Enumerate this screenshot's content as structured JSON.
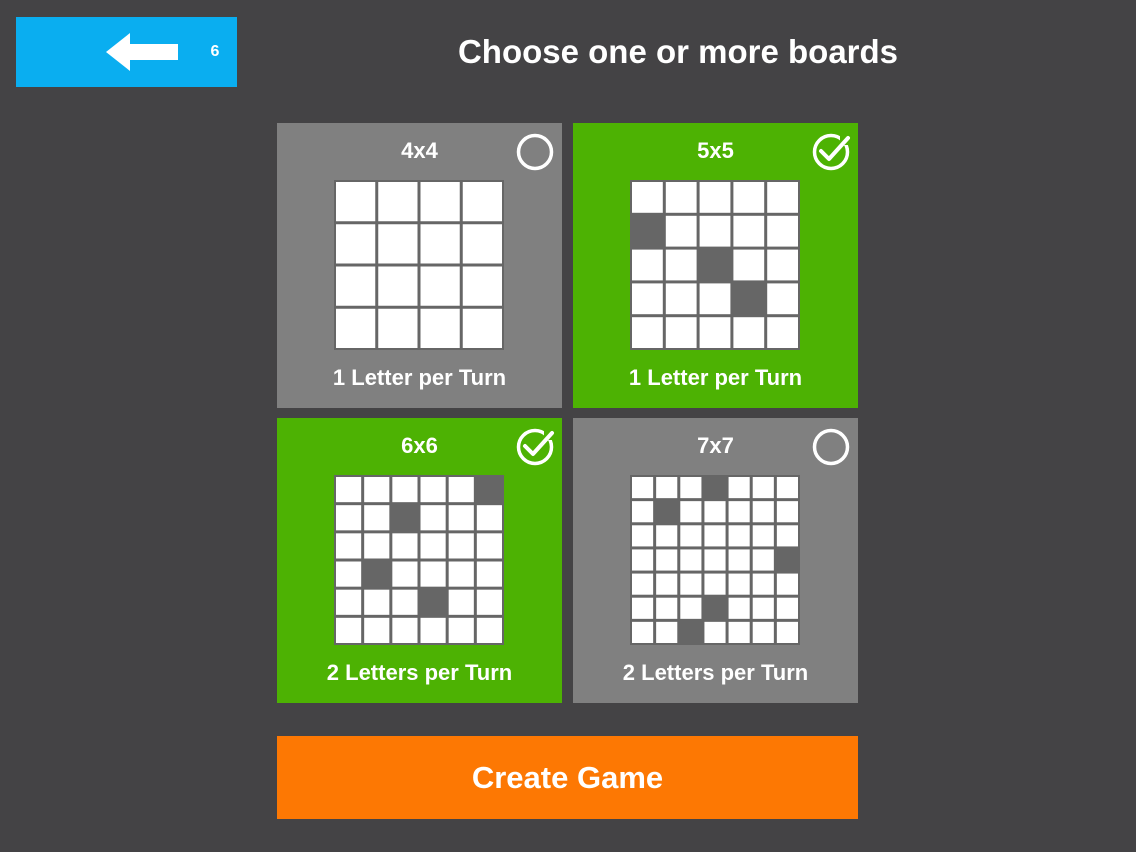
{
  "header": {
    "back_count": "6",
    "title": "Choose one or more boards",
    "back_color": "#0aaef0"
  },
  "boards": [
    {
      "size_label": "4x4",
      "n": 4,
      "mode_label": "1 Letter per Turn",
      "selected": false,
      "dark_cells": []
    },
    {
      "size_label": "5x5",
      "n": 5,
      "mode_label": "1 Letter per Turn",
      "selected": true,
      "dark_cells": [
        [
          1,
          0
        ],
        [
          2,
          2
        ],
        [
          3,
          3
        ]
      ]
    },
    {
      "size_label": "6x6",
      "n": 6,
      "mode_label": "2 Letters per Turn",
      "selected": true,
      "dark_cells": [
        [
          0,
          5
        ],
        [
          1,
          2
        ],
        [
          3,
          1
        ],
        [
          4,
          3
        ]
      ]
    },
    {
      "size_label": "7x7",
      "n": 7,
      "mode_label": "2 Letters per Turn",
      "selected": false,
      "dark_cells": [
        [
          0,
          3
        ],
        [
          1,
          1
        ],
        [
          3,
          6
        ],
        [
          5,
          3
        ],
        [
          6,
          2
        ]
      ]
    }
  ],
  "create_button": {
    "label": "Create Game",
    "color": "#fd7803"
  },
  "colors": {
    "background": "#444345",
    "card_default": "#808080",
    "card_selected": "#4db203",
    "cell": "#ffffff"
  }
}
